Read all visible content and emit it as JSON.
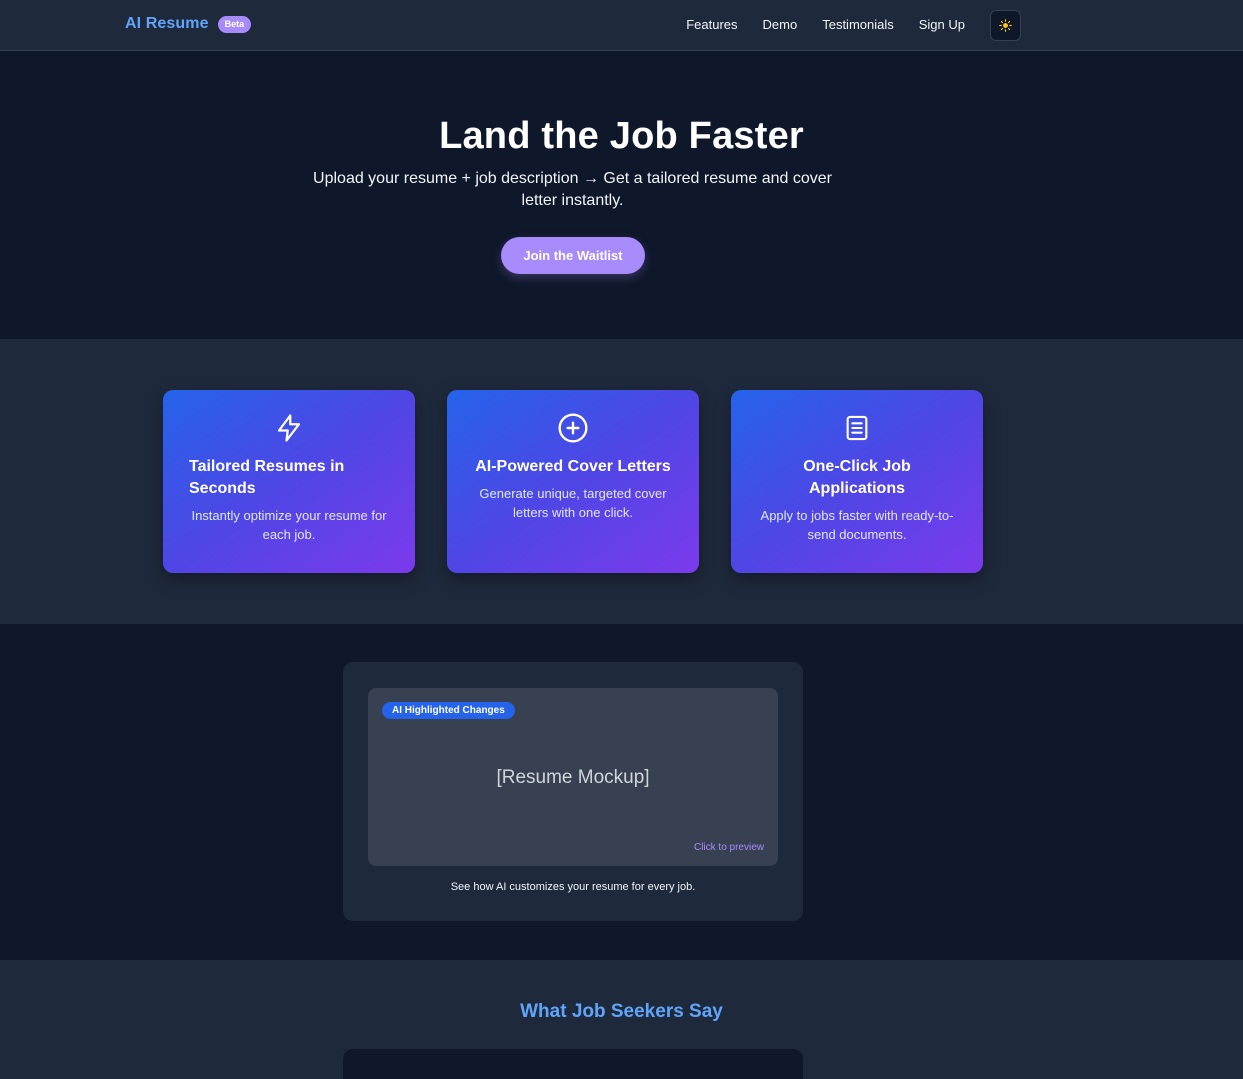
{
  "nav": {
    "brand": "AI Resume",
    "badge": "Beta",
    "links": [
      "Features",
      "Demo",
      "Testimonials",
      "Sign Up"
    ],
    "theme_toggle_icon": "sun-icon"
  },
  "hero": {
    "title": "Land the Job Faster",
    "subtitle": "Upload your resume + job description → Get a tailored resume and cover letter instantly.",
    "cta_label": "Join the Waitlist"
  },
  "features": [
    {
      "icon": "lightning-icon",
      "title": "Tailored Resumes in Seconds",
      "description": "Instantly optimize your resume for each job."
    },
    {
      "icon": "plus-circle-icon",
      "title": "AI-Powered Cover Letters",
      "description": "Generate unique, targeted cover letters with one click."
    },
    {
      "icon": "document-icon",
      "title": "One-Click Job Applications",
      "description": "Apply to jobs faster with ready-to-send documents."
    }
  ],
  "demo": {
    "badge": "AI Highlighted Changes",
    "placeholder": "[Resume Mockup]",
    "hint": "Click to preview",
    "caption": "See how AI customizes your resume for every job."
  },
  "testimonials": {
    "title": "What Job Seekers Say"
  },
  "colors": {
    "background": "#0f172a",
    "surface": "#1e293b",
    "brand": "#60a5fa",
    "accent": "#a78bfa",
    "card_gradient_start": "#2563eb",
    "card_gradient_end": "#7c3aed"
  }
}
